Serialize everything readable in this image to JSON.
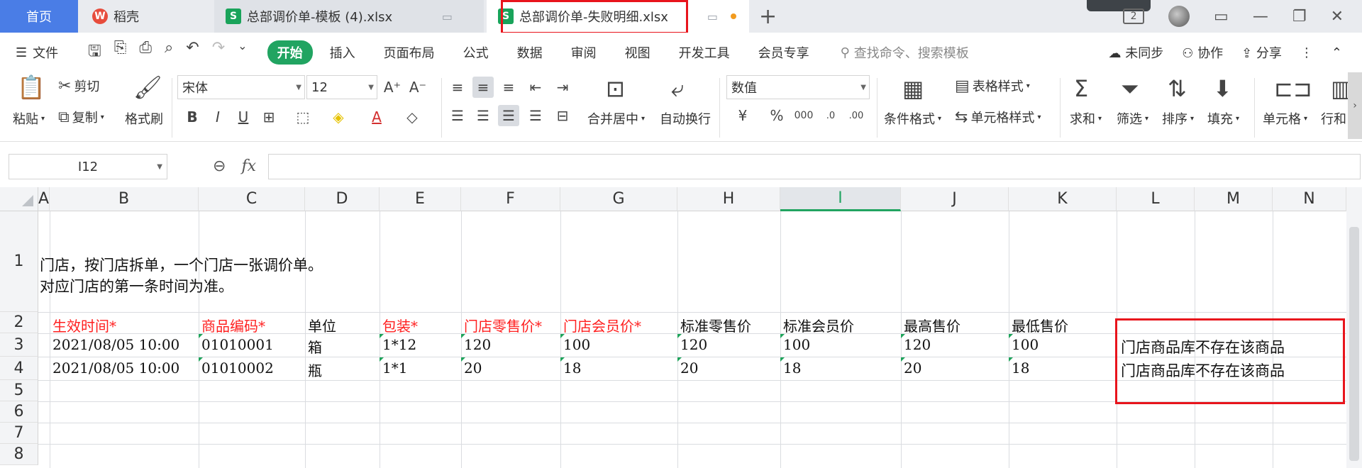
{
  "tabs": {
    "home": "首页",
    "daoke": "稻壳",
    "file1": "总部调价单-模板 (4).xlsx",
    "file2": "总部调价单-失败明细.xlsx",
    "xls_letter": "S"
  },
  "menu": {
    "file": "文件",
    "items": [
      "开始",
      "插入",
      "页面布局",
      "公式",
      "数据",
      "审阅",
      "视图",
      "开发工具",
      "会员专享"
    ],
    "search_placeholder": "查找命令、搜索模板",
    "sync": "未同步",
    "collab": "协作",
    "share": "分享",
    "badge": "2"
  },
  "ribbon": {
    "paste": "粘贴",
    "cut": "剪切",
    "copy": "复制",
    "format_painter": "格式刷",
    "font_name": "宋体",
    "font_size": "12",
    "merge_center": "合并居中",
    "wrap": "自动换行",
    "number_format": "数值",
    "cond_format": "条件格式",
    "table_style": "表格样式",
    "cell_style": "单元格样式",
    "sum": "求和",
    "filter": "筛选",
    "sort": "排序",
    "fill": "填充",
    "cell": "单元格",
    "rowcol": "行和"
  },
  "formula_bar": {
    "cell_ref": "I12",
    "fx": "fx",
    "value": ""
  },
  "sheet": {
    "columns": [
      "A",
      "B",
      "C",
      "D",
      "E",
      "F",
      "G",
      "H",
      "I",
      "J",
      "K",
      "L",
      "M",
      "N"
    ],
    "selected_column": "I",
    "rows": [
      "1",
      "2",
      "3",
      "4",
      "5",
      "6",
      "7",
      "8"
    ],
    "note_lines": [
      "门店，按门店拆单，一个门店一张调价单。",
      "对应门店的第一条时间为准。"
    ],
    "headers": [
      "生效时间*",
      "商品编码*",
      "单位",
      "包装*",
      "门店零售价*",
      "门店会员价*",
      "标准零售价",
      "标准会员价",
      "最高售价",
      "最低售价"
    ],
    "data_rows": [
      [
        "2021/08/05 10:00",
        "01010001",
        "箱",
        "1*12",
        "120",
        "100",
        "120",
        "100",
        "120",
        "100",
        "门店商品库不存在该商品"
      ],
      [
        "2021/08/05 10:00",
        "01010002",
        "瓶",
        "1*1",
        "20",
        "18",
        "20",
        "18",
        "20",
        "18",
        "门店商品库不存在该商品"
      ]
    ]
  }
}
